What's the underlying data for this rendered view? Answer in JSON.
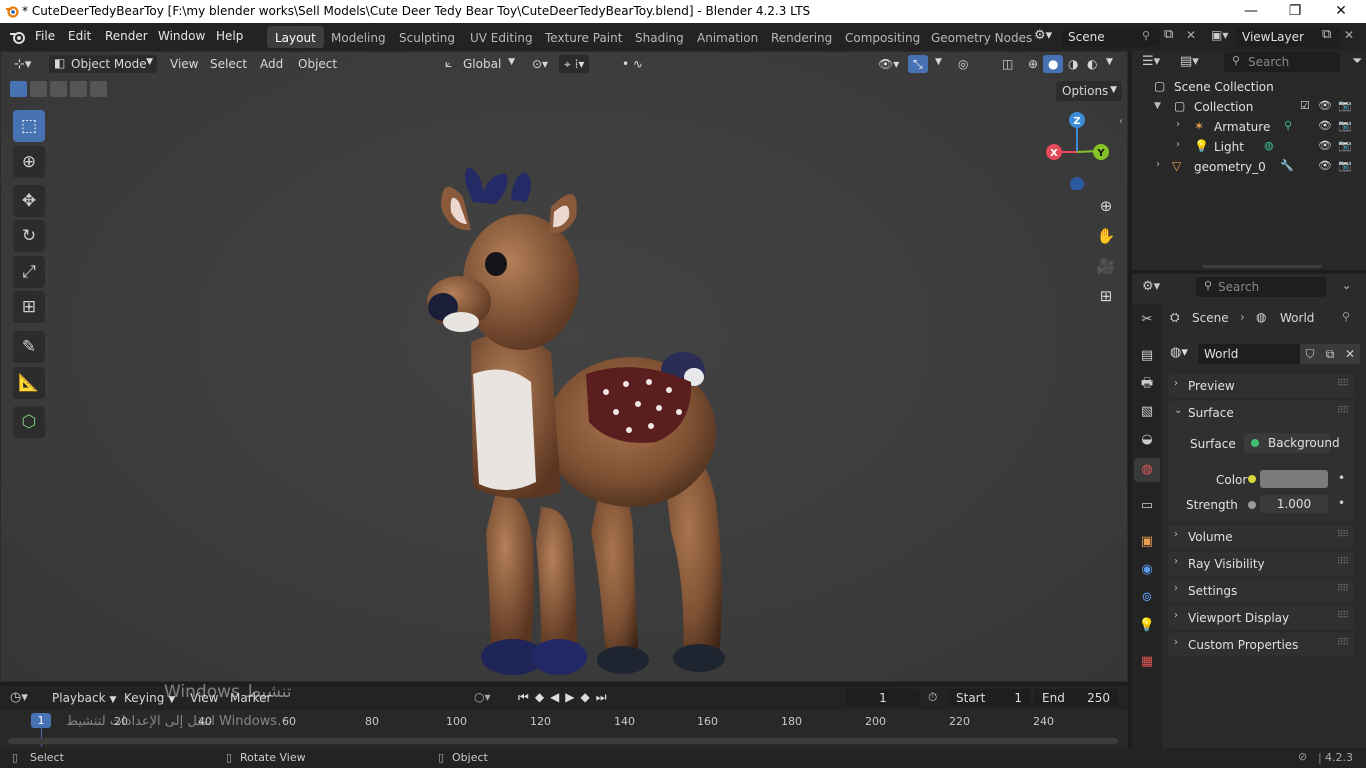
{
  "window": {
    "title": "* CuteDeerTedyBearToy [F:\\my blender works\\Sell Models\\Cute Deer Tedy Bear Toy\\CuteDeerTedyBearToy.blend] - Blender 4.2.3 LTS",
    "minimize": "—",
    "maximize": "❐",
    "close": "✕"
  },
  "menu": {
    "file": "File",
    "edit": "Edit",
    "render": "Render",
    "window": "Window",
    "help": "Help"
  },
  "workspaces": [
    "Layout",
    "Modeling",
    "Sculpting",
    "UV Editing",
    "Texture Paint",
    "Shading",
    "Animation",
    "Rendering",
    "Compositing",
    "Geometry Nodes"
  ],
  "scene_field": "Scene",
  "viewlayer_field": "ViewLayer",
  "viewport": {
    "mode": "Object Mode",
    "view": "View",
    "select": "Select",
    "add": "Add",
    "object": "Object",
    "orientation": "Global",
    "options": "Options",
    "gizmo": {
      "x": "X",
      "y": "Y",
      "z": "Z"
    }
  },
  "outliner": {
    "search_placeholder": "Search",
    "scene_collection": "Scene Collection",
    "collection": "Collection",
    "armature": "Armature",
    "light": "Light",
    "geometry": "geometry_0"
  },
  "properties": {
    "search_placeholder": "Search",
    "breadcrumb_scene": "Scene",
    "breadcrumb_world": "World",
    "world_name": "World",
    "panels": {
      "preview": "Preview",
      "surface": "Surface",
      "volume": "Volume",
      "ray_visibility": "Ray Visibility",
      "settings": "Settings",
      "viewport_display": "Viewport Display",
      "custom_properties": "Custom Properties"
    },
    "surface_label": "Surface",
    "surface_value": "Background",
    "color_label": "Color",
    "color_value": "#7a7a7a",
    "strength_label": "Strength",
    "strength_value": "1.000"
  },
  "timeline": {
    "playback": "Playback",
    "keying": "Keying",
    "view": "View",
    "marker": "Marker",
    "current_frame": "1",
    "start_label": "Start",
    "start_value": "1",
    "end_label": "End",
    "end_value": "250",
    "playhead": "1",
    "ticks": [
      "20",
      "40",
      "60",
      "80",
      "100",
      "120",
      "140",
      "160",
      "180",
      "200",
      "220",
      "240"
    ]
  },
  "watermark": {
    "line1": "Windows تنشيط",
    "line2": "انتقل إلى الإعدادات لتنشيط Windows."
  },
  "status": {
    "select": "Select",
    "rotate_view": "Rotate View",
    "object": "Object",
    "version": "4.2.3"
  },
  "colors": {
    "accent": "#4772b3",
    "x_axis": "#e64a5a",
    "y_axis": "#84c226",
    "z_axis": "#3b8bd8"
  }
}
